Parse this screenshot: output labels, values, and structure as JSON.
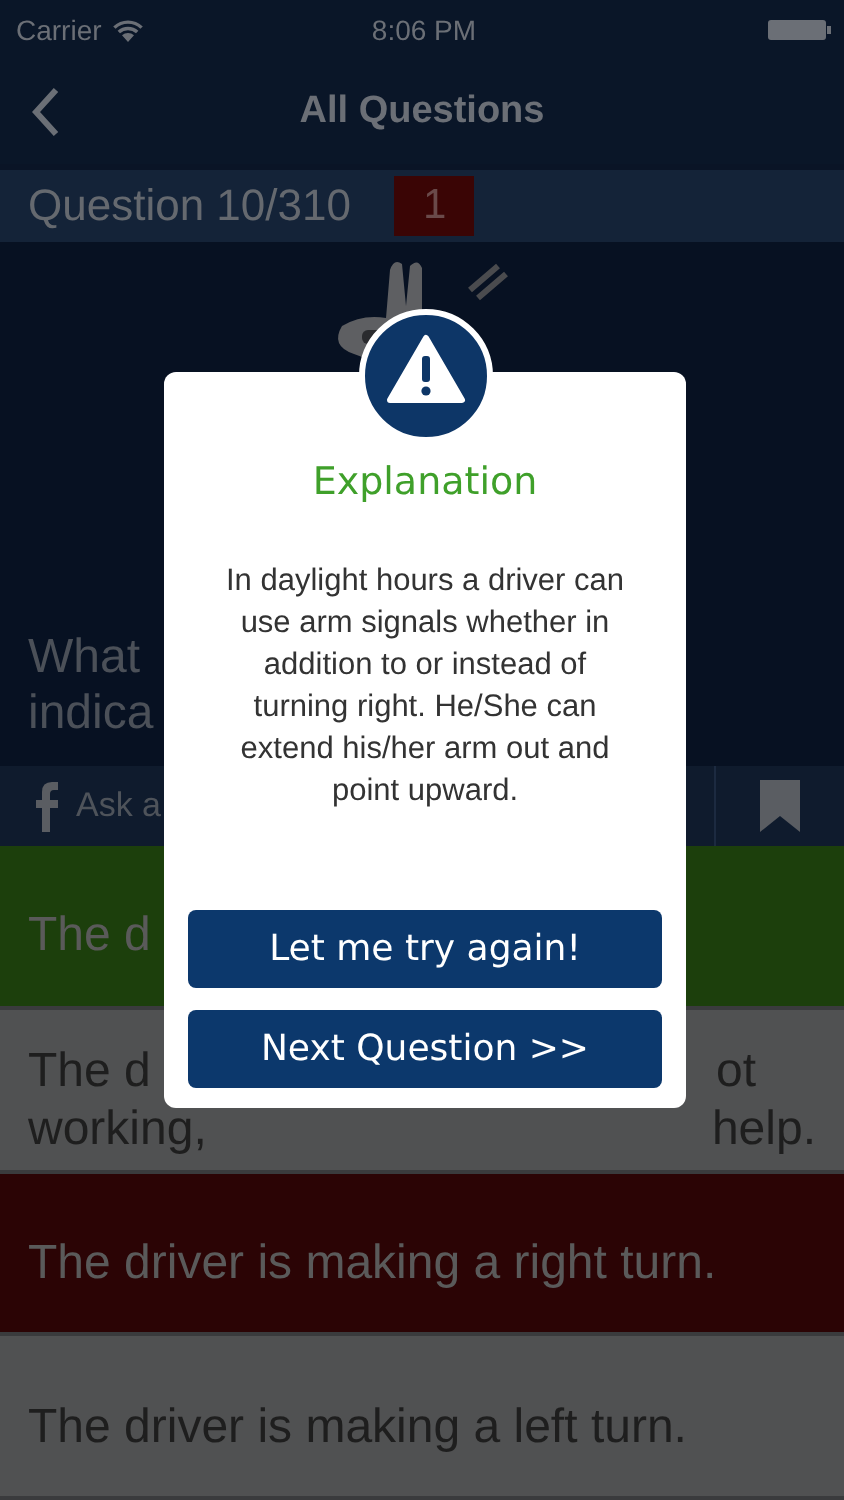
{
  "status_bar": {
    "carrier": "Carrier",
    "time": "8:06 PM"
  },
  "nav": {
    "title": "All Questions"
  },
  "question_bar": {
    "label": "Question 10/310",
    "badge": "1"
  },
  "question": {
    "lines": [
      "What",
      "indica"
    ]
  },
  "share_bar": {
    "label": "Ask a"
  },
  "answers": [
    {
      "kind": "correct",
      "lines": [
        [
          "The d"
        ]
      ]
    },
    {
      "kind": "neutral",
      "lines": [
        [
          "The d",
          "ot"
        ],
        [
          "working,",
          "help."
        ]
      ]
    },
    {
      "kind": "wrong",
      "lines": [
        [
          "The driver is making a right turn."
        ]
      ]
    },
    {
      "kind": "neutral",
      "lines": [
        [
          "The driver is making a left turn."
        ]
      ]
    }
  ],
  "dialog": {
    "title": "Explanation",
    "body": "In daylight hours a driver can use arm signals whether in addition to or instead of turning right. He/She can extend his/her arm out and point upward.",
    "buttons": [
      "Let me try again!",
      "Next Question >>"
    ]
  }
}
